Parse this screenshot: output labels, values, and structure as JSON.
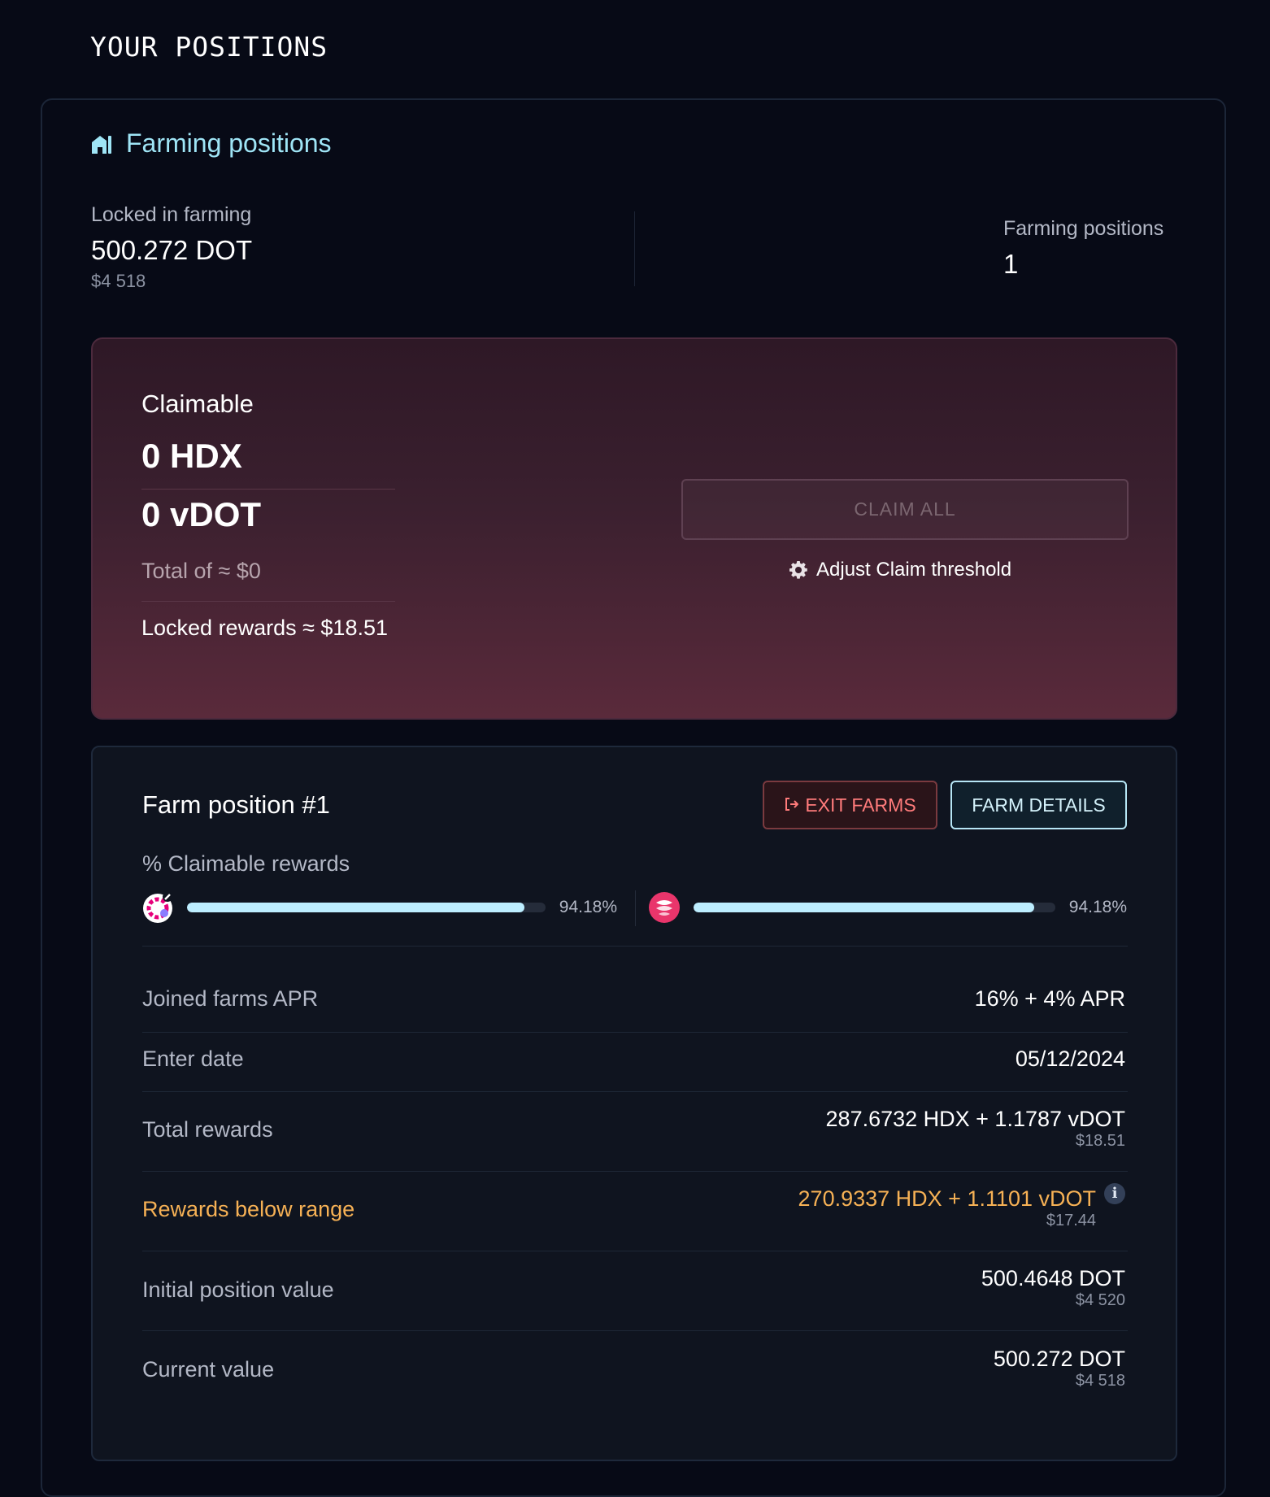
{
  "page": {
    "heading": "YOUR POSITIONS"
  },
  "section": {
    "title": "Farming positions",
    "icon": "farm-barn-icon"
  },
  "stats": {
    "locked_label": "Locked in farming",
    "locked_value": "500.272 DOT",
    "locked_usd": "$4 518",
    "positions_label": "Farming positions",
    "positions_value": "1"
  },
  "claim": {
    "title": "Claimable",
    "amounts": [
      "0 HDX",
      "0 vDOT"
    ],
    "total": "Total of ≈ $0",
    "locked_rewards": "Locked rewards ≈ $18.51",
    "button_label": "CLAIM ALL",
    "adjust_label": "Adjust Claim threshold",
    "adjust_icon": "gear-icon"
  },
  "farm": {
    "title": "Farm position #1",
    "exit_label": "EXIT FARMS",
    "exit_icon": "exit-icon",
    "details_label": "FARM DETAILS",
    "rewards_label": "% Claimable rewards",
    "progress": [
      {
        "token_icon": "vdot-token-icon",
        "percent": 94.18,
        "label": "94.18%"
      },
      {
        "token_icon": "hdx-token-icon",
        "percent": 94.18,
        "label": "94.18%"
      }
    ],
    "rows": [
      {
        "label": "Joined farms APR",
        "value": "16% + 4% APR"
      },
      {
        "label": "Enter date",
        "value": "05/12/2024"
      },
      {
        "label": "Total rewards",
        "value": "287.6732 HDX + 1.1787 vDOT",
        "sub": "$18.51"
      },
      {
        "label": "Rewards below range",
        "value": "270.9337 HDX + 1.1101 vDOT",
        "sub": "$17.44",
        "info_icon": "info-icon",
        "info_glyph": "i"
      },
      {
        "label": "Initial position value",
        "value": "500.4648 DOT",
        "sub": "$4 520"
      },
      {
        "label": "Current value",
        "value": "500.272 DOT",
        "sub": "$4 518"
      }
    ]
  },
  "colors": {
    "background": "#070a16",
    "accent": "#9fe5f6",
    "progress_fill": "#bdeeff",
    "warning": "#f6b155",
    "exit_red": "#ff7b7b"
  }
}
